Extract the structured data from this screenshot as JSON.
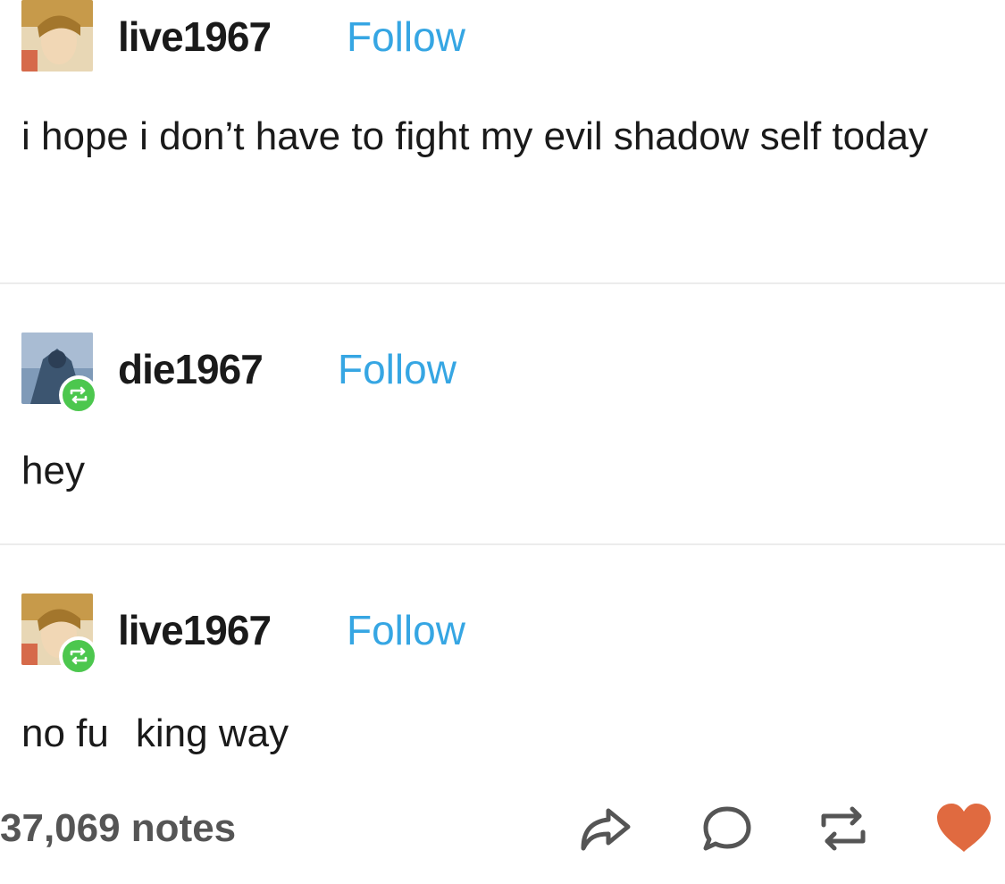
{
  "posts": [
    {
      "username": "live1967",
      "follow_label": "Follow",
      "text": "i hope i don’t have to fight my evil shadow self today",
      "reblogged": false
    },
    {
      "username": "die1967",
      "follow_label": "Follow",
      "text": "hey",
      "reblogged": true
    },
    {
      "username": "live1967",
      "follow_label": "Follow",
      "text_before": "no fu",
      "text_after": "king way",
      "reblogged": true
    }
  ],
  "footer": {
    "notes": "37,069 notes",
    "actions": [
      "share-icon",
      "reply-icon",
      "reblog-icon",
      "like-icon"
    ]
  },
  "colors": {
    "follow": "#36a6e3",
    "reblog_badge": "#4cc74e",
    "like": "#e06a40",
    "text": "#1a1a1a"
  }
}
